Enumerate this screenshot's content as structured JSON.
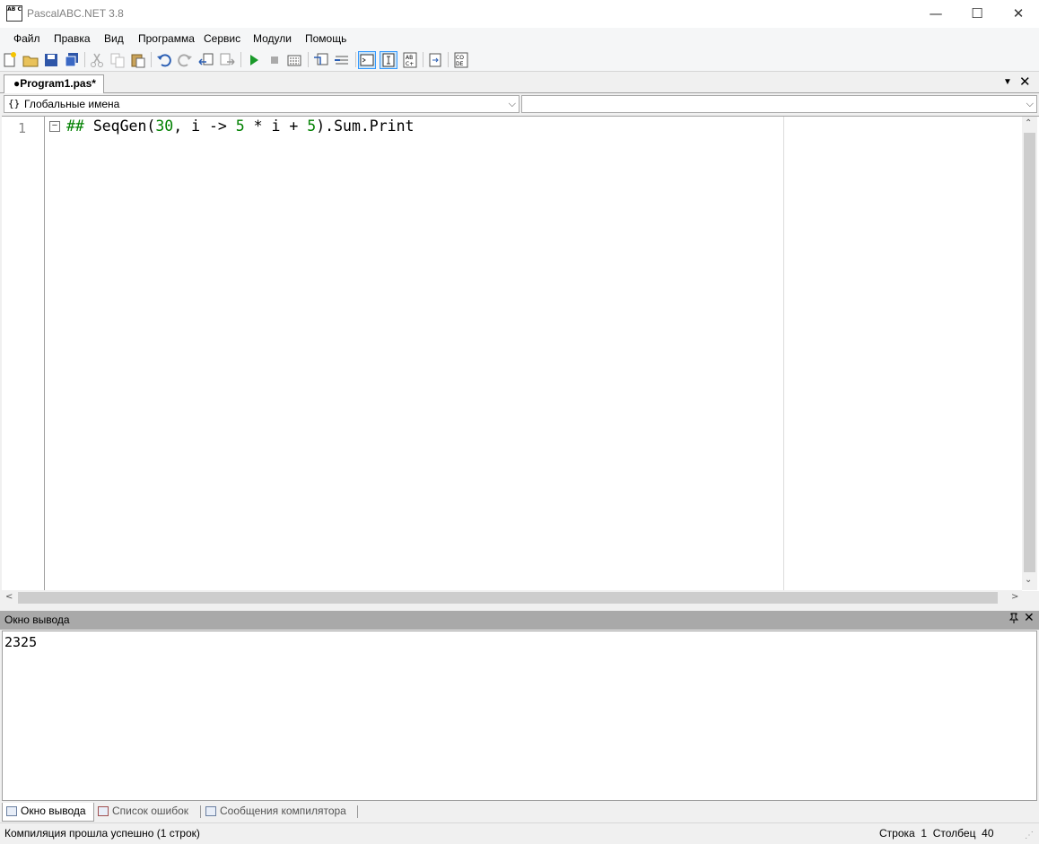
{
  "window": {
    "title": "PascalABC.NET 3.8",
    "icon_text": "AB C"
  },
  "titlebar_buttons": {
    "minimize": "—",
    "maximize": "☐",
    "close": "✕"
  },
  "menu": [
    "Файл",
    "Правка",
    "Вид",
    "Программа",
    "Сервис",
    "Модули",
    "Помощь"
  ],
  "toolbar": {
    "icons": [
      "new-file-icon",
      "open-folder-icon",
      "save-icon",
      "save-all-icon",
      "cut-icon",
      "copy-icon",
      "paste-icon",
      "undo-icon",
      "redo-icon",
      "navigate-back-icon",
      "navigate-forward-icon",
      "run-icon",
      "stop-icon",
      "compile-icon",
      "debug-step-into-icon",
      "debug-step-over-icon",
      "console-output-icon",
      "text-window-icon",
      "spell-check-icon",
      "form-designer-icon",
      "code-template-icon"
    ]
  },
  "document_tab": {
    "label": "●Program1.pas*",
    "list_glyph": "▼",
    "close_glyph": "✕"
  },
  "combos": {
    "left_label": "Глобальные имена",
    "left_icon": "{}",
    "right_label": "",
    "arrow": "⌵"
  },
  "editor": {
    "line_number": "1",
    "fold_glyph": "−",
    "code_tokens": [
      {
        "text": "## ",
        "color": "green"
      },
      {
        "text": "SeqGen(",
        "color": "black"
      },
      {
        "text": "30",
        "color": "green"
      },
      {
        "text": ", i -> ",
        "color": "black"
      },
      {
        "text": "5",
        "color": "green"
      },
      {
        "text": " * i + ",
        "color": "black"
      },
      {
        "text": "5",
        "color": "green"
      },
      {
        "text": ").Sum.Print",
        "color": "black"
      }
    ]
  },
  "scroll": {
    "up": "⌃",
    "down": "⌄",
    "left": "<",
    "right": ">"
  },
  "output_panel": {
    "title": "Окно вывода",
    "pin_glyph": "📌",
    "close_glyph": "✕",
    "text": "2325"
  },
  "bottom_tabs": [
    {
      "label": "Окно вывода",
      "active": true
    },
    {
      "label": "Список ошибок",
      "active": false
    },
    {
      "label": "Сообщения компилятора",
      "active": false
    }
  ],
  "status": {
    "message": "Компиляция прошла успешно (1 строк)",
    "row_label": "Строка",
    "row_value": "1",
    "col_label": "Столбец",
    "col_value": "40",
    "grip": "⋰"
  },
  "colors": {
    "code_green": "#008000",
    "active_tb_border": "#3399ff",
    "panel_header": "#a9a9a9"
  }
}
